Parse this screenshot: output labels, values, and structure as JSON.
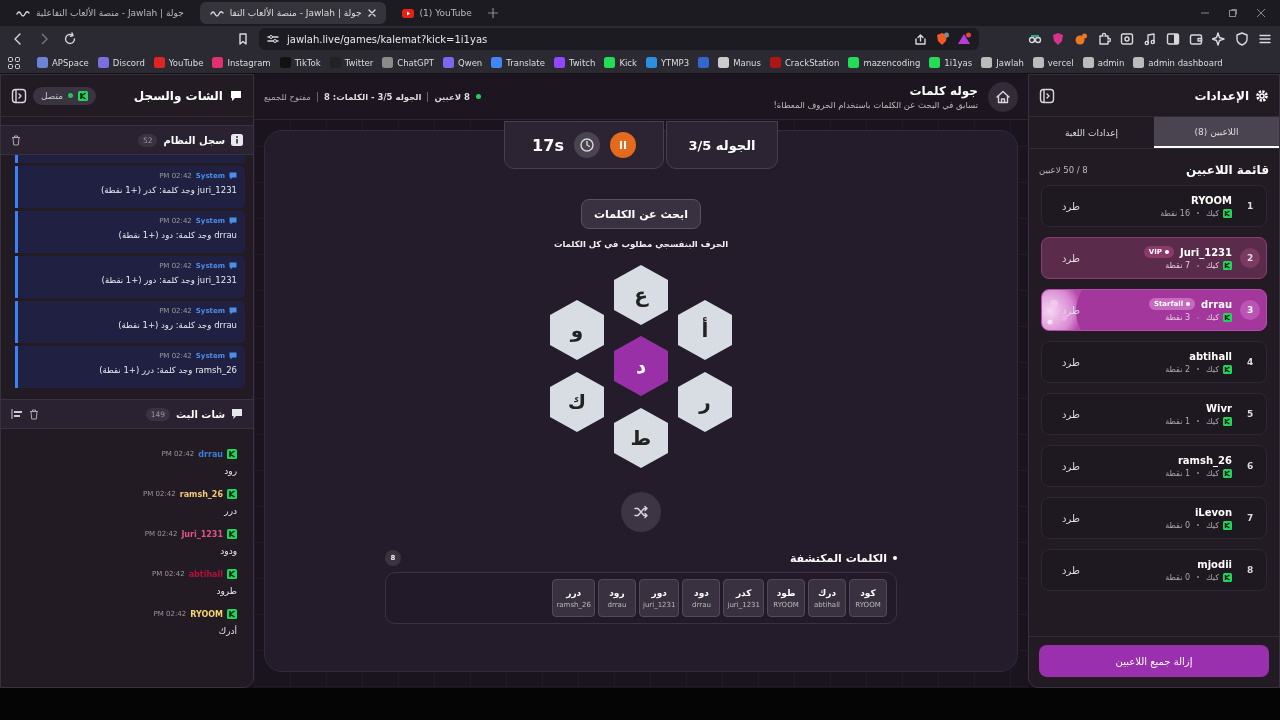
{
  "browser": {
    "tabs": [
      {
        "title": "(1) YouTube",
        "kind": "youtube",
        "selected": false
      },
      {
        "title": "جولة | Jawlah - منصة الألعاب التفا",
        "kind": "site",
        "selected": true
      },
      {
        "title": "جولة | Jawlah - منصة الألعاب التفاعلية",
        "kind": "site",
        "selected": false
      }
    ],
    "address": "jawlah.live/games/kalemat?kick=1i1yas",
    "bookmarks": [
      {
        "label": "admin dashboard",
        "color": "#bbbbbb"
      },
      {
        "label": "admin",
        "color": "#bbbbbb"
      },
      {
        "label": "vercel",
        "color": "#bbbbbb"
      },
      {
        "label": "Jawlah",
        "color": "#bbbbbb"
      },
      {
        "label": "1i1yas",
        "color": "#22dd55"
      },
      {
        "label": "mazencoding",
        "color": "#22dd55"
      },
      {
        "label": "CrackStation",
        "color": "#b01515"
      },
      {
        "label": "Manus",
        "color": "#cccccc"
      },
      {
        "color": "#3566c9"
      },
      {
        "label": "YTMP3",
        "color": "#2b8fe0"
      },
      {
        "label": "Kick",
        "color": "#22dd55"
      },
      {
        "label": "Twitch",
        "color": "#9146ff"
      },
      {
        "label": "Translate",
        "color": "#4285f4"
      },
      {
        "label": "Qwen",
        "color": "#7b68ee"
      },
      {
        "label": "ChatGPT",
        "color": "#8a8a8a"
      },
      {
        "label": "Twitter",
        "color": "#222222"
      },
      {
        "label": "TikTok",
        "color": "#111111"
      },
      {
        "label": "Instagram",
        "color": "#e1306c"
      },
      {
        "label": "YouTube",
        "color": "#e02424"
      },
      {
        "label": "Discord",
        "color": "#7a6fe0"
      },
      {
        "label": "APSpace",
        "color": "#6d83d6"
      }
    ]
  },
  "settings_panel": {
    "title": "الإعدادات",
    "tabs": [
      {
        "label": "اللاعبين (8)",
        "selected": true
      },
      {
        "label": "إعدادات اللعبة",
        "selected": false
      }
    ],
    "list_title": "قائمة اللاعبين",
    "capacity": "8 / 50 لاعبين",
    "players": [
      {
        "rank": "1",
        "name": "RYOOM",
        "kind": "normal",
        "platform": "كيك",
        "points": "16 نقطة",
        "kick": "طرد"
      },
      {
        "rank": "2",
        "name": "Juri_1231",
        "kind": "vip",
        "badge": "VIP",
        "platform": "كيك",
        "points": "7 نقطة",
        "kick": "طرد"
      },
      {
        "rank": "3",
        "name": "drrau",
        "kind": "starfall",
        "badge": "Starfall",
        "platform": "كيك",
        "points": "3 نقطة",
        "kick": "طرد"
      },
      {
        "rank": "4",
        "name": "abtihall",
        "kind": "normal",
        "platform": "كيك",
        "points": "2 نقطة",
        "kick": "طرد"
      },
      {
        "rank": "5",
        "name": "Wivr",
        "kind": "normal",
        "platform": "كيك",
        "points": "1 نقطة",
        "kick": "طرد"
      },
      {
        "rank": "6",
        "name": "ramsh_26",
        "kind": "normal",
        "platform": "كيك",
        "points": "1 نقطة",
        "kick": "طرد"
      },
      {
        "rank": "7",
        "name": "iLevon",
        "kind": "normal",
        "platform": "كيك",
        "points": "0 نقطة",
        "kick": "طرد"
      },
      {
        "rank": "8",
        "name": "mjodii",
        "kind": "normal",
        "platform": "كيك",
        "points": "0 نقطة",
        "kick": "طرد"
      }
    ],
    "remove_all": "إزالة جميع اللاعبين"
  },
  "game": {
    "title": "جوله كلمات",
    "subtitle": "تسابق في البحث عن الكلمات باستخدام الحروف المعطاة!",
    "players_count": "8 لاعبين",
    "round_info": "الجوله 3/5 - الكلمات: 8",
    "access": "مفتوح للجميع",
    "round": "الجوله 3/5",
    "timer": "17s",
    "search_button": "ابحث عن الكلمات",
    "hint": "الحرف البنفسجي مطلوب في كل الكلمات",
    "letters": [
      {
        "letter": "ع",
        "required": false
      },
      {
        "letter": "أ",
        "required": false
      },
      {
        "letter": "و",
        "required": false
      },
      {
        "letter": "د",
        "required": true
      },
      {
        "letter": "ر",
        "required": false
      },
      {
        "letter": "ك",
        "required": false
      },
      {
        "letter": "ط",
        "required": false
      }
    ],
    "found": {
      "title": "الكلمات المكتشفة",
      "count": "8",
      "words": [
        {
          "word": "كود",
          "player": "RYOOM"
        },
        {
          "word": "درك",
          "player": "abtihall"
        },
        {
          "word": "طود",
          "player": "RYOOM"
        },
        {
          "word": "كدر",
          "player": "juri_1231"
        },
        {
          "word": "دود",
          "player": "drrau"
        },
        {
          "word": "دور",
          "player": "juri_1231"
        },
        {
          "word": "رود",
          "player": "drrau"
        },
        {
          "word": "درر",
          "player": "ramsh_26"
        }
      ]
    }
  },
  "chat_panel": {
    "title": "الشات والسجل",
    "status": "متصل",
    "connected": true,
    "system_log": {
      "title": "سجل النظام",
      "count": "52",
      "entries": [
        {
          "source": "System",
          "time": "02:42 PM",
          "text": "juri_1231 وجد كلمة: كدر (+1 نقطة)"
        },
        {
          "source": "System",
          "time": "02:42 PM",
          "text": "drrau وجد كلمة: دود (+1 نقطة)"
        },
        {
          "source": "System",
          "time": "02:42 PM",
          "text": "juri_1231 وجد كلمة: دور (+1 نقطة)"
        },
        {
          "source": "System",
          "time": "02:42 PM",
          "text": "drrau وجد كلمة: رود (+1 نقطة)"
        },
        {
          "source": "System",
          "time": "02:42 PM",
          "text": "ramsh_26 وجد كلمة: درر (+1 نقطة)"
        }
      ]
    },
    "stream_chat": {
      "title": "شات البث",
      "count": "149",
      "messages": [
        {
          "user": "drrau",
          "color": "#3b7fd9",
          "time": "02:42 PM",
          "text": "رود"
        },
        {
          "user": "ramsh_26",
          "color": "#f3c77c",
          "time": "02:42 PM",
          "text": "درر"
        },
        {
          "user": "Juri_1231",
          "color": "#e0508a",
          "time": "02:42 PM",
          "text": "ودود"
        },
        {
          "user": "abtihall",
          "color": "#b5123a",
          "time": "02:42 PM",
          "text": "طرود"
        },
        {
          "user": "RYOOM",
          "color": "#f5d36e",
          "time": "02:42 PM",
          "text": "أدرك"
        }
      ]
    }
  }
}
